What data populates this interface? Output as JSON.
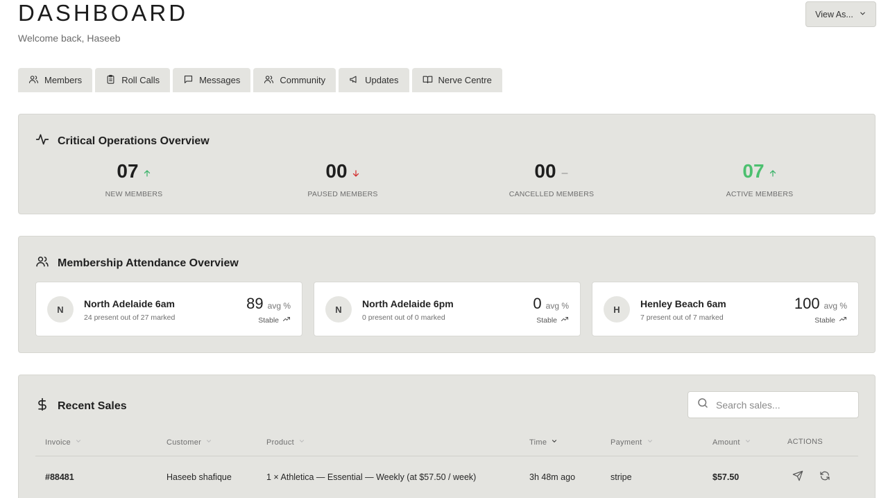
{
  "header": {
    "title": "DASHBOARD",
    "subtitle": "Welcome back, Haseeb",
    "view_as_label": "View As..."
  },
  "tabs": [
    {
      "label": "Members",
      "icon": "users-icon"
    },
    {
      "label": "Roll Calls",
      "icon": "clipboard-icon"
    },
    {
      "label": "Messages",
      "icon": "message-icon"
    },
    {
      "label": "Community",
      "icon": "users-icon"
    },
    {
      "label": "Updates",
      "icon": "megaphone-icon"
    },
    {
      "label": "Nerve Centre",
      "icon": "book-open-icon"
    }
  ],
  "critical": {
    "title": "Critical Operations Overview",
    "stats": [
      {
        "value": "07",
        "label": "NEW MEMBERS",
        "trend": "up",
        "color": "#1e1e1e",
        "trend_color": "#3bb36a"
      },
      {
        "value": "00",
        "label": "PAUSED MEMBERS",
        "trend": "down",
        "color": "#1e1e1e",
        "trend_color": "#d22d2d"
      },
      {
        "value": "00",
        "label": "CANCELLED MEMBERS",
        "trend": "flat",
        "color": "#1e1e1e",
        "trend_color": "#8a8a8a"
      },
      {
        "value": "07",
        "label": "ACTIVE MEMBERS",
        "trend": "up",
        "color": "#4cc06f",
        "trend_color": "#3bb36a"
      }
    ]
  },
  "attendance": {
    "title": "Membership Attendance Overview",
    "cards": [
      {
        "initial": "N",
        "name": "North Adelaide 6am",
        "sub": "24 present out of 27 marked",
        "value": "89",
        "unit": "avg %",
        "trend": "Stable"
      },
      {
        "initial": "N",
        "name": "North Adelaide 6pm",
        "sub": "0 present out of 0 marked",
        "value": "0",
        "unit": "avg %",
        "trend": "Stable"
      },
      {
        "initial": "H",
        "name": "Henley Beach 6am",
        "sub": "7 present out of 7 marked",
        "value": "100",
        "unit": "avg %",
        "trend": "Stable"
      }
    ]
  },
  "sales": {
    "title": "Recent Sales",
    "search_placeholder": "Search sales...",
    "columns": [
      "Invoice",
      "Customer",
      "Product",
      "Time",
      "Payment",
      "Amount",
      "ACTIONS"
    ],
    "rows": [
      {
        "invoice": "#88481",
        "customer": "Haseeb shafique",
        "product": "1 × Athletica — Essential — Weekly (at $57.50 / week)",
        "time": "3h 48m ago",
        "payment": "stripe",
        "amount": "$57.50"
      }
    ]
  }
}
